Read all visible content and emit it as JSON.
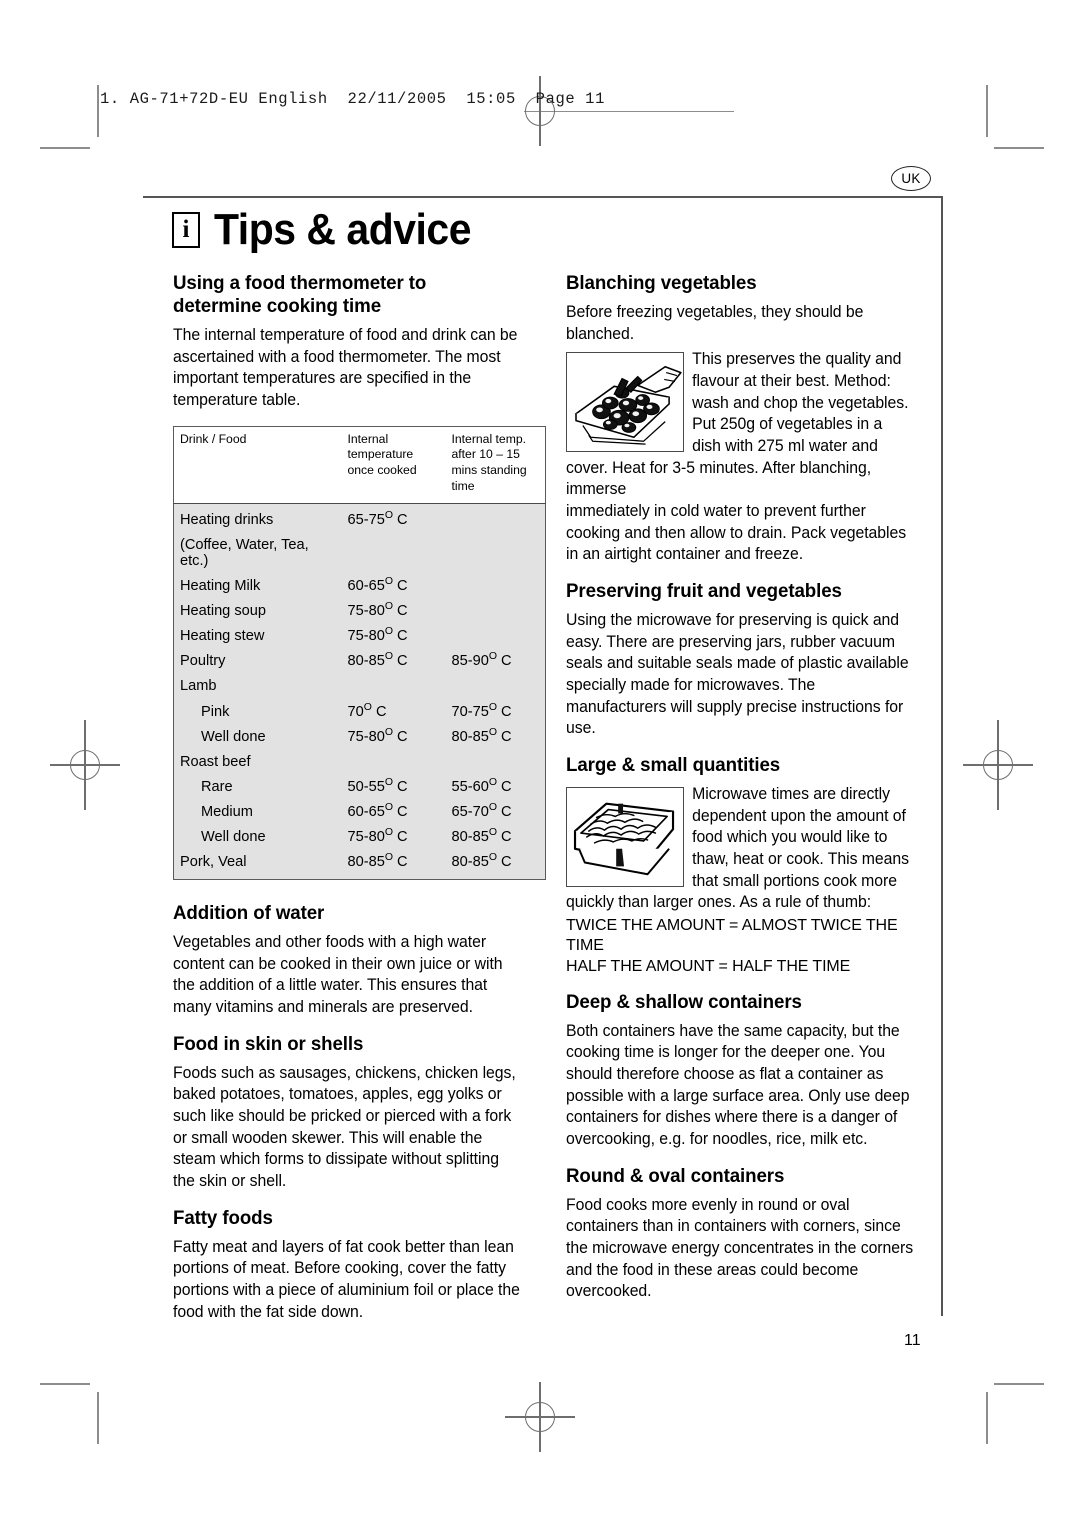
{
  "prepress": {
    "slug": "1. AG-71+72D-EU English  22/11/2005  15:05  Page 11"
  },
  "page": {
    "locale_badge": "UK",
    "title": "Tips & advice",
    "info_icon_glyph": "i",
    "page_number": "11"
  },
  "left_column": {
    "sections": [
      {
        "heading": "Using a food thermometer to determine cooking time",
        "paragraphs": [
          "The internal temperature of food and drink can be ascertained with a food thermometer. The most important temperatures are specified in the temperature table."
        ]
      },
      {
        "heading": "Addition of water",
        "paragraphs": [
          "Vegetables and other foods with a high water content can be cooked in their own juice or with the addition of a little water. This ensures that many vitamins and minerals are preserved."
        ]
      },
      {
        "heading": "Food in skin or shells",
        "paragraphs": [
          "Foods such as sausages, chickens, chicken legs, baked potatoes, tomatoes, apples, egg yolks or such like should be pricked or pierced with a fork or small wooden skewer. This will enable the steam which forms to dissipate without splitting the skin or shell."
        ]
      },
      {
        "heading": "Fatty foods",
        "paragraphs": [
          "Fatty meat and layers of fat cook better than lean portions of meat. Before cooking, cover the fatty portions with a piece of aluminium foil or place the food with the fat side down."
        ]
      }
    ]
  },
  "temperature_table": {
    "headers": [
      "Drink / Food",
      "Internal temperature once cooked",
      "Internal temp. after 10 – 15 mins standing time"
    ],
    "rows": [
      {
        "food": "Heating drinks",
        "indent": false,
        "internal": "65-75",
        "internal_unit": "O C",
        "standing": "",
        "standing_unit": ""
      },
      {
        "food": "(Coffee, Water, Tea, etc.)",
        "indent": false,
        "internal": "",
        "internal_unit": "",
        "standing": "",
        "standing_unit": ""
      },
      {
        "food": "Heating Milk",
        "indent": false,
        "internal": "60-65",
        "internal_unit": "O C",
        "standing": "",
        "standing_unit": ""
      },
      {
        "food": "Heating soup",
        "indent": false,
        "internal": "75-80",
        "internal_unit": "O C",
        "standing": "",
        "standing_unit": ""
      },
      {
        "food": "Heating stew",
        "indent": false,
        "internal": "75-80",
        "internal_unit": "O C",
        "standing": "",
        "standing_unit": ""
      },
      {
        "food": "Poultry",
        "indent": false,
        "internal": "80-85",
        "internal_unit": "O C",
        "standing": "85-90",
        "standing_unit": "O C"
      },
      {
        "food": "Lamb",
        "indent": false,
        "internal": "",
        "internal_unit": "",
        "standing": "",
        "standing_unit": ""
      },
      {
        "food": "Pink",
        "indent": true,
        "internal": "70",
        "internal_unit": "O C",
        "standing": "70-75",
        "standing_unit": "O C"
      },
      {
        "food": "Well done",
        "indent": true,
        "internal": "75-80",
        "internal_unit": "O C",
        "standing": "80-85",
        "standing_unit": "O C"
      },
      {
        "food": "Roast beef",
        "indent": false,
        "internal": "",
        "internal_unit": "",
        "standing": "",
        "standing_unit": ""
      },
      {
        "food": "Rare",
        "indent": true,
        "internal": "50-55",
        "internal_unit": "O C",
        "standing": "55-60",
        "standing_unit": "O C"
      },
      {
        "food": "Medium",
        "indent": true,
        "internal": "60-65",
        "internal_unit": "O C",
        "standing": "65-70",
        "standing_unit": "O C"
      },
      {
        "food": "Well done",
        "indent": true,
        "internal": "75-80",
        "internal_unit": "O C",
        "standing": "80-85",
        "standing_unit": "O C"
      },
      {
        "food": "Pork, Veal",
        "indent": false,
        "internal": "80-85",
        "internal_unit": "O C",
        "standing": "80-85",
        "standing_unit": "O C"
      }
    ]
  },
  "right_column": {
    "blanching": {
      "heading": "Blanching vegetables",
      "intro": "Before freezing vegetables, they should be blanched.",
      "figure_name": "vegetables-on-tray-illustration",
      "wrapped_text": "This preserves the quality and flavour at their best. Method: wash and chop the vegetables. Put 250g of vegetables in a dish with 275 ml water and cover. Heat for 3-5 minutes.  After blanching, immerse",
      "continued_text": "immediately in cold water to prevent further cooking and then allow to drain. Pack vegetables in an airtight container and freeze."
    },
    "preserving": {
      "heading": "Preserving fruit and vegetables",
      "paragraph": "Using the microwave for preserving is quick and easy. There are preserving jars, rubber vacuum seals and suitable seals made of plastic available specially made for microwaves. The manufacturers will supply precise instructions for use."
    },
    "quantities": {
      "heading": "Large & small quantities",
      "figure_name": "shallow-dish-illustration",
      "wrapped_text": "Microwave times are directly dependent upon the amount of food which you would like to thaw, heat or cook. This means that small portions cook more quickly than larger ones. As a rule of thumb:",
      "rule_line_1": "TWICE THE AMOUNT = ALMOST TWICE THE TIME",
      "rule_line_2": "HALF THE AMOUNT = HALF THE TIME"
    },
    "deep_shallow": {
      "heading": "Deep & shallow containers",
      "paragraph": "Both containers have the same capacity, but the cooking time is longer for the deeper one. You should therefore choose as flat a container as possible with a large surface area. Only use deep containers for dishes where there is a danger of overcooking, e.g. for noodles, rice, milk etc."
    },
    "round_oval": {
      "heading": "Round & oval containers",
      "paragraph": "Food cooks more evenly in round or oval containers than in containers with corners, since the microwave energy concentrates in the corners and the food in these areas could become overcooked."
    }
  },
  "colors": {
    "table_fill": "#e2e2e2",
    "rule": "#555555",
    "mark": "#8d8d8d"
  }
}
